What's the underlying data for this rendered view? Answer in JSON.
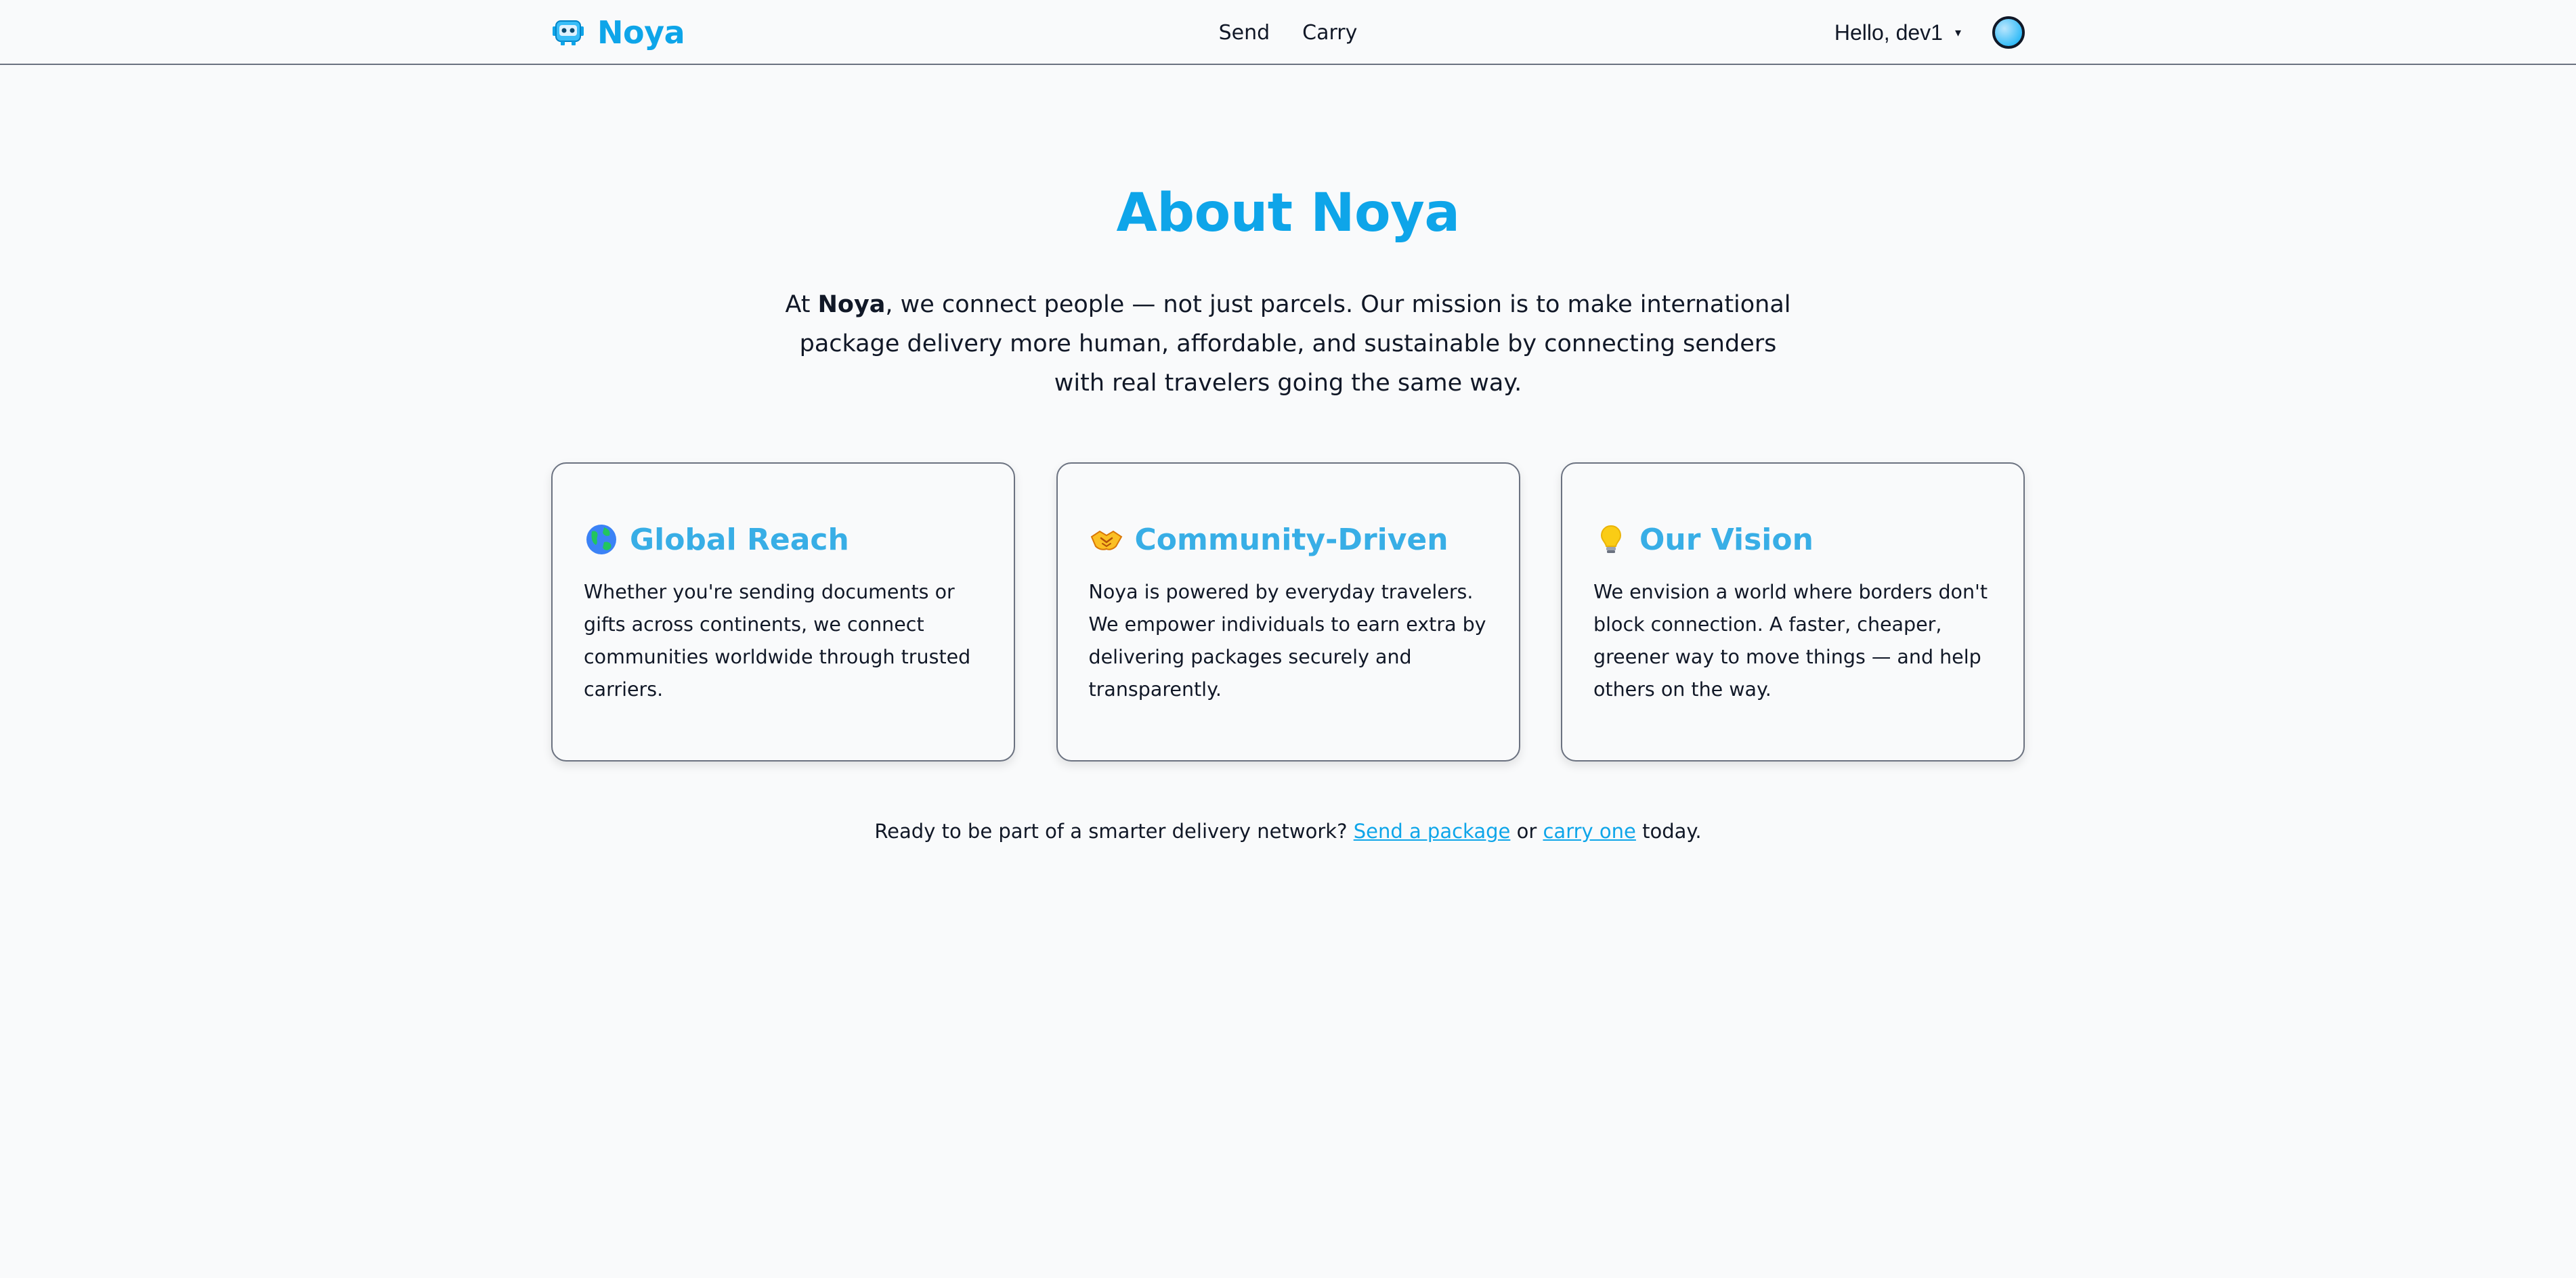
{
  "nav": {
    "brand": "Noya",
    "links": [
      "Send",
      "Carry"
    ],
    "user_greeting": "Hello, dev1",
    "caret": "▾"
  },
  "about": {
    "title": "About Noya",
    "intro_prefix": "At ",
    "intro_bold": "Noya",
    "intro_rest": ", we connect people — not just parcels. Our mission is to make international package delivery more human, affordable, and sustainable by connecting senders with real travelers going the same way."
  },
  "cards": [
    {
      "icon": "globe-icon",
      "title": "Global Reach",
      "body": "Whether you're sending documents or gifts across continents, we connect communities worldwide through trusted carriers."
    },
    {
      "icon": "handshake-icon",
      "title": "Community-Driven",
      "body": "Noya is powered by everyday travelers. We empower individuals to earn extra by delivering packages securely and transparently."
    },
    {
      "icon": "lightbulb-icon",
      "title": "Our Vision",
      "body": "We envision a world where borders don't block connection. A faster, cheaper, greener way to move things — and help others on the way."
    }
  ],
  "cta": {
    "prefix": "Ready to be part of a smarter delivery network? ",
    "send_link": "Send a package",
    "middle": " or ",
    "carry_link": "carry one",
    "suffix": " today."
  },
  "colors": {
    "brand": "#0ea5e9",
    "card_title": "#38aee6",
    "background": "#f9fafb",
    "text": "#111827"
  }
}
